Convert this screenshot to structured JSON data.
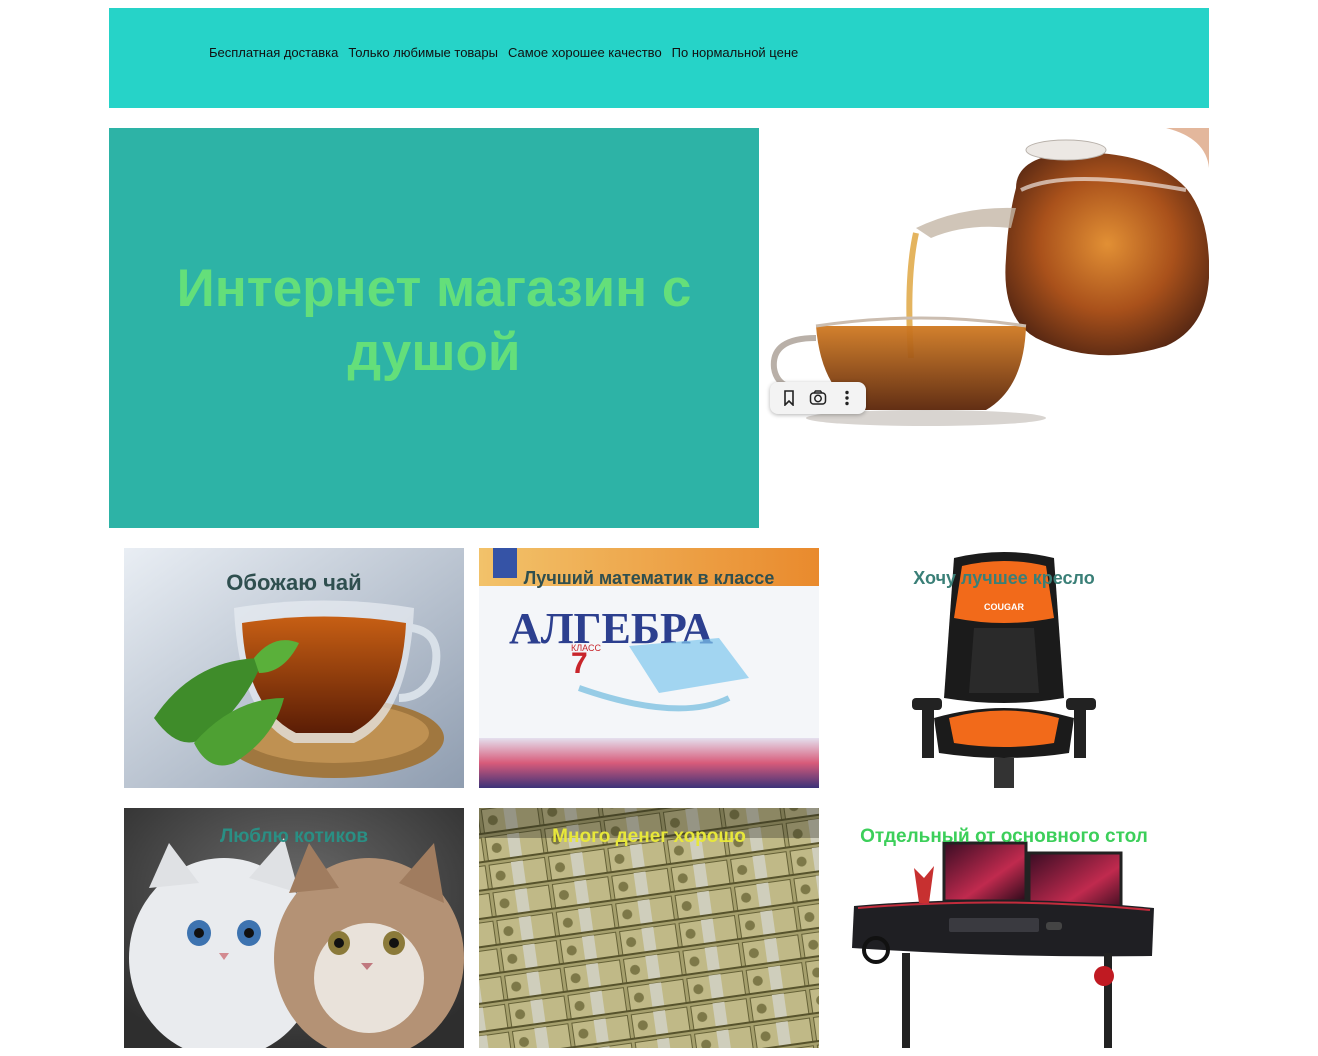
{
  "header": {
    "nav": [
      "Бесплатная доставка",
      "Только любимые товары",
      "Самое хорошее качество",
      "По нормальной цене"
    ]
  },
  "hero": {
    "title": "Интернет магазин с душой"
  },
  "image_toolbar": {
    "icons": [
      "bookmark-icon",
      "lens-search-icon",
      "more-vertical-icon"
    ]
  },
  "cards": [
    {
      "title": "Обожаю чай",
      "title_color": "#2f4f4f"
    },
    {
      "title": "Лучший математик в классе",
      "title_color": "#2f4f4f"
    },
    {
      "title": "Хочу лучшее кресло",
      "title_color": "#3a7f77"
    },
    {
      "title": "Люблю котиков",
      "title_color": "#2a8f84"
    },
    {
      "title": "Много денег хорошо",
      "title_color": "#e8e83a"
    },
    {
      "title": "Отдельный от основного стол",
      "title_color": "#3ccf5a"
    }
  ],
  "algebra_book": {
    "title": "АЛГЕБРА",
    "grade_number": "7",
    "grade_word": "КЛАСС"
  },
  "chair_brand": "COUGAR",
  "colors": {
    "topbar": "#26d3c8",
    "hero_bg": "#2db3a6",
    "hero_text": "#64df7a"
  }
}
